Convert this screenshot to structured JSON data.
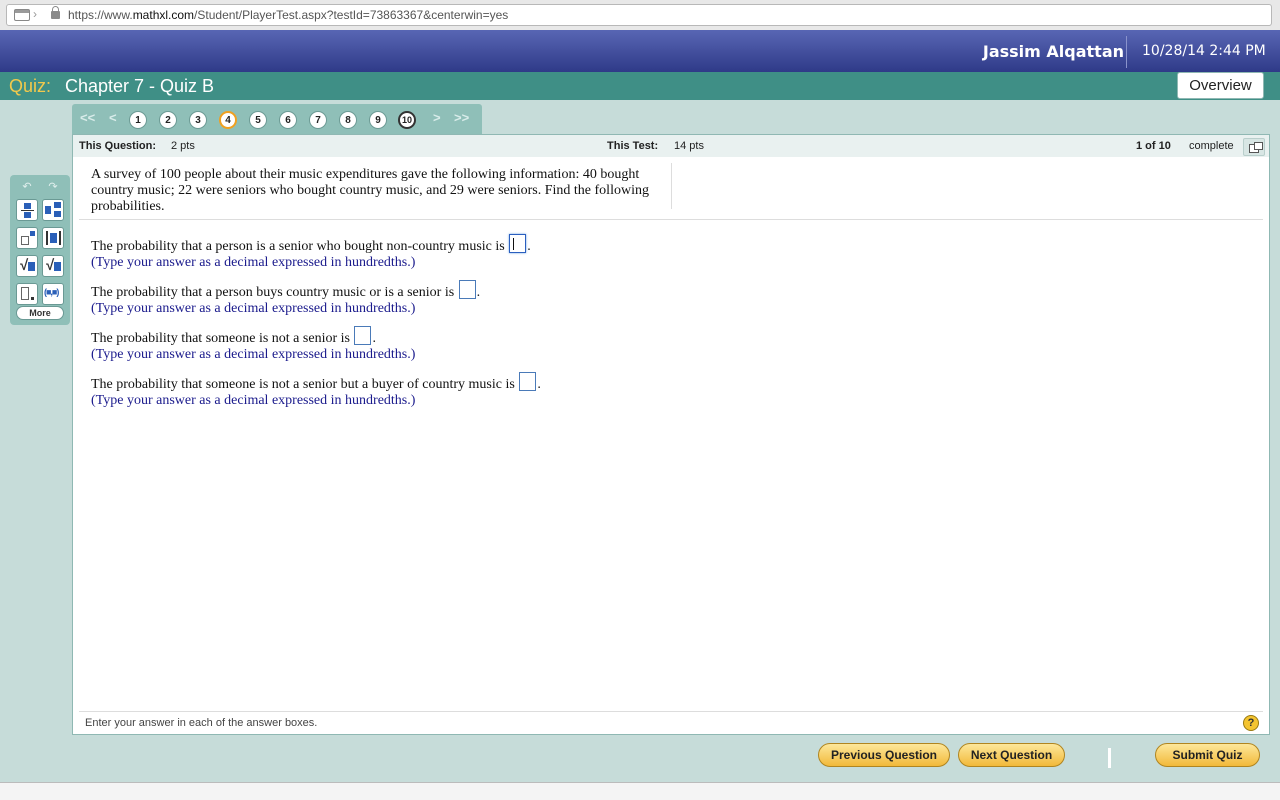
{
  "browser": {
    "url_prefix": "https://www.",
    "url_domain": "mathxl.com",
    "url_path": "/Student/PlayerTest.aspx?testId=73863367&centerwin=yes"
  },
  "header": {
    "user_name": "Jassim Alqattan",
    "datetime": "10/28/14 2:44 PM"
  },
  "titlebar": {
    "quiz_label": "Quiz:",
    "quiz_title": "Chapter 7 - Quiz B",
    "overview_label": "Overview"
  },
  "question_nav": {
    "first": "<<",
    "prev": "<",
    "next": ">",
    "last": ">>",
    "questions": [
      "1",
      "2",
      "3",
      "4",
      "5",
      "6",
      "7",
      "8",
      "9",
      "10"
    ],
    "current_question": 4
  },
  "info": {
    "this_question_label": "This Question:",
    "this_question_pts": "2 pts",
    "this_test_label": "This Test:",
    "this_test_pts": "14 pts",
    "progress": "1 of 10",
    "complete_label": "complete"
  },
  "problem": {
    "text": "A survey of 100 people about their music expenditures gave the following information: 40 bought country music; 22 were seniors who bought country music, and 29 were seniors. Find the following probabilities.",
    "parts": [
      {
        "prompt": "The probability that a person is a senior who bought non-country music is",
        "hint": "(Type your answer as a decimal expressed in hundredths.)"
      },
      {
        "prompt": "The probability that a person buys country music or is a senior is",
        "hint": "(Type your answer as a decimal expressed in hundredths.)"
      },
      {
        "prompt": "The probability that someone is not a senior is",
        "hint": "(Type your answer as a decimal expressed in hundredths.)"
      },
      {
        "prompt": "The probability that someone is not a senior but a buyer of country music is",
        "hint": "(Type your answer as a decimal expressed in hundredths.)"
      }
    ]
  },
  "footer": {
    "instruction": "Enter your answer in each of the answer boxes.",
    "help_symbol": "?"
  },
  "toolbar": {
    "undo": "↶",
    "redo": "↷",
    "sqrt": "√",
    "interval": "(■,■)",
    "more_label": "More"
  },
  "buttons": {
    "previous": "Previous Question",
    "next": "Next Question",
    "submit": "Submit Quiz"
  },
  "colors": {
    "header_navy": "#2f3a88",
    "title_teal": "#3f8f86",
    "quiz_label_gold": "#f2c94c",
    "background_mint": "#c6dcd9",
    "hint_blue": "#1a1a8c",
    "button_gold": "#f2b93a"
  }
}
